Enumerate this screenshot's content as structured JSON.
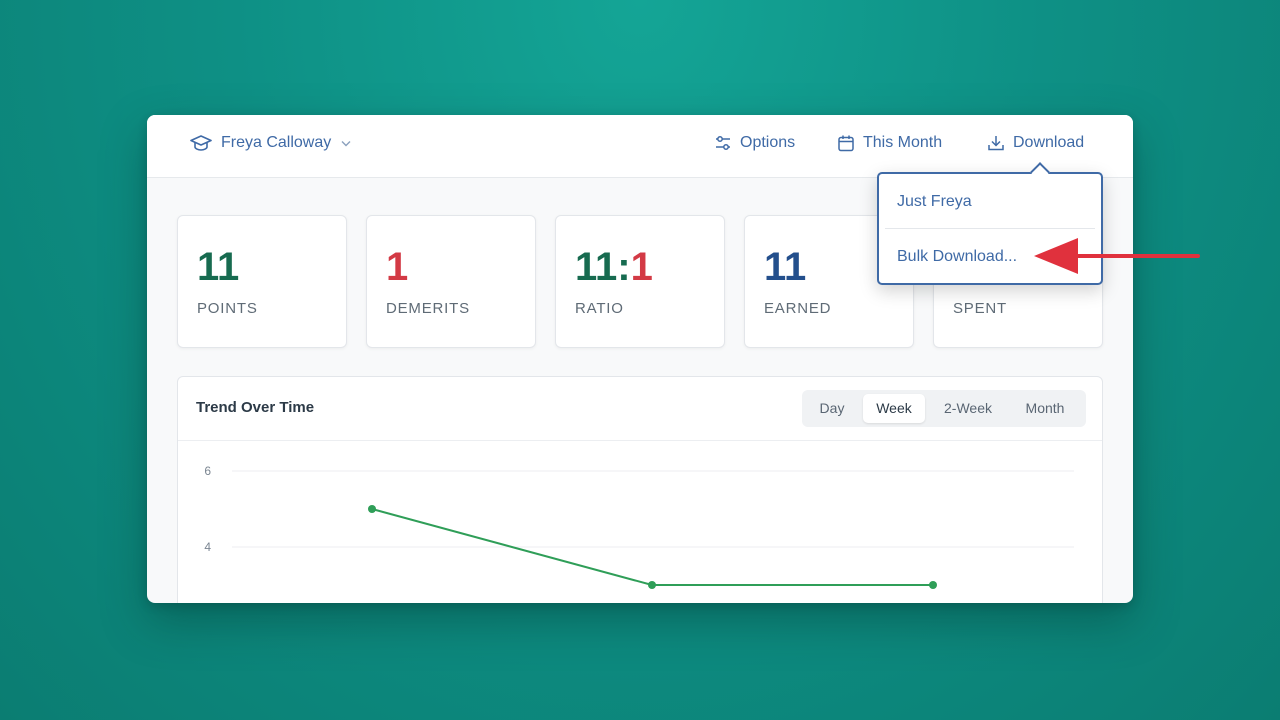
{
  "header": {
    "student_name": "Freya Calloway",
    "options_label": "Options",
    "period_label": "This Month",
    "download_label": "Download"
  },
  "stats": [
    {
      "value": "11",
      "label": "POINTS",
      "color": "#176b50"
    },
    {
      "value": "1",
      "label": "DEMERITS",
      "color": "#d33a45"
    },
    {
      "value_left": "11",
      "value_sep": ":",
      "value_right": "1",
      "label": "RATIO"
    },
    {
      "value": "11",
      "label": "EARNED",
      "color": "#234f8c"
    },
    {
      "value": "",
      "label": "SPENT"
    }
  ],
  "trend": {
    "title": "Trend Over Time",
    "ranges": [
      "Day",
      "Week",
      "2-Week",
      "Month"
    ],
    "active_range": "Week"
  },
  "chart_data": {
    "type": "line",
    "x": [
      1,
      2,
      3
    ],
    "y_ticks": [
      "6",
      "4"
    ],
    "series": [
      {
        "values": [
          5,
          3,
          3
        ],
        "color": "#2f9e58"
      }
    ],
    "ylim": [
      2.5,
      6.6
    ],
    "grid": true
  },
  "download_menu": {
    "items": [
      "Just Freya",
      "Bulk Download..."
    ]
  },
  "colors": {
    "accent": "#3f6aa6",
    "background": "#0e9085",
    "annotation_arrow": "#e0313d"
  }
}
